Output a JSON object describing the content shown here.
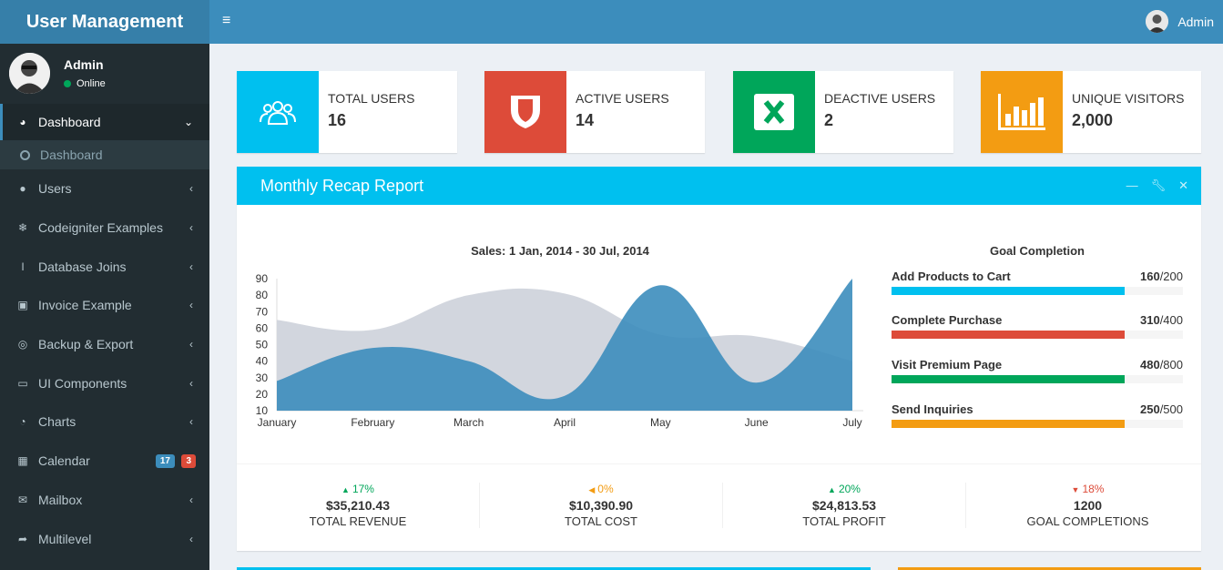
{
  "header": {
    "app_title": "User Management",
    "user_name": "Admin"
  },
  "sidebar": {
    "user": {
      "name": "Admin",
      "status": "Online"
    },
    "items": [
      {
        "label": "Dashboard",
        "icon": "dashboard-icon",
        "glyph": "◕",
        "chev": "⌄"
      },
      {
        "label": "Users",
        "icon": "user-icon",
        "glyph": "●",
        "chev": "‹"
      },
      {
        "label": "Codeigniter Examples",
        "icon": "snowflake-icon",
        "glyph": "❄",
        "chev": "‹"
      },
      {
        "label": "Database Joins",
        "icon": "cursor-icon",
        "glyph": "I",
        "chev": "‹"
      },
      {
        "label": "Invoice Example",
        "icon": "money-icon",
        "glyph": "▣",
        "chev": "‹"
      },
      {
        "label": "Backup & Export",
        "icon": "lifebuoy-icon",
        "glyph": "◎",
        "chev": "‹"
      },
      {
        "label": "UI Components",
        "icon": "laptop-icon",
        "glyph": "▭",
        "chev": "‹"
      },
      {
        "label": "Charts",
        "icon": "pie-chart-icon",
        "glyph": "◔",
        "chev": "‹"
      },
      {
        "label": "Calendar",
        "icon": "calendar-icon",
        "glyph": "▦",
        "badges": [
          "17",
          "3"
        ]
      },
      {
        "label": "Mailbox",
        "icon": "envelope-icon",
        "glyph": "✉",
        "chev": "‹"
      },
      {
        "label": "Multilevel",
        "icon": "share-icon",
        "glyph": "➦",
        "chev": "‹"
      }
    ],
    "submenu": "Dashboard"
  },
  "info_boxes": [
    {
      "text": "TOTAL USERS",
      "number": "16",
      "color": "#00c0ef",
      "icon": "users-icon"
    },
    {
      "text": "ACTIVE USERS",
      "number": "14",
      "color": "#dd4b39",
      "icon": "shield-icon"
    },
    {
      "text": "DEACTIVE USERS",
      "number": "2",
      "color": "#00a65a",
      "icon": "excel-icon"
    },
    {
      "text": "UNIQUE VISITORS",
      "number": "2,000",
      "color": "#f39c12",
      "icon": "bar-chart-icon"
    }
  ],
  "report": {
    "title": "Monthly Recap Report",
    "chart_title": "Sales: 1 Jan, 2014 - 30 Jul, 2014",
    "goal_title": "Goal Completion",
    "goals": [
      {
        "label": "Add Products to Cart",
        "value": "160",
        "total": "/200",
        "pct": 0.8,
        "color": "#00c0ef"
      },
      {
        "label": "Complete Purchase",
        "value": "310",
        "total": "/400",
        "pct": 0.8,
        "color": "#dd4b39"
      },
      {
        "label": "Visit Premium Page",
        "value": "480",
        "total": "/800",
        "pct": 0.8,
        "color": "#00a65a"
      },
      {
        "label": "Send Inquiries",
        "value": "250",
        "total": "/500",
        "pct": 0.8,
        "color": "#f39c12"
      }
    ],
    "footer": [
      {
        "pct": "17%",
        "arrow": "▲",
        "color": "#00a65a",
        "amount": "$35,210.43",
        "label": "TOTAL REVENUE"
      },
      {
        "pct": "0%",
        "arrow": "◀",
        "color": "#f39c12",
        "amount": "$10,390.90",
        "label": "TOTAL COST"
      },
      {
        "pct": "20%",
        "arrow": "▲",
        "color": "#00a65a",
        "amount": "$24,813.53",
        "label": "TOTAL PROFIT"
      },
      {
        "pct": "18%",
        "arrow": "▼",
        "color": "#dd4b39",
        "amount": "1200",
        "label": "GOAL COMPLETIONS"
      }
    ]
  },
  "chart_data": {
    "type": "area",
    "title": "Sales: 1 Jan, 2014 - 30 Jul, 2014",
    "categories": [
      "January",
      "February",
      "March",
      "April",
      "May",
      "June",
      "July"
    ],
    "ylim": [
      10,
      90
    ],
    "yticks": [
      10,
      20,
      30,
      40,
      50,
      60,
      70,
      80,
      90
    ],
    "series": [
      {
        "values": [
          65,
          59,
          80,
          81,
          56,
          55,
          40
        ],
        "color": "#d2d6de"
      },
      {
        "values": [
          28,
          48,
          40,
          19,
          86,
          27,
          90
        ],
        "color": "#3c8dbc"
      }
    ]
  }
}
